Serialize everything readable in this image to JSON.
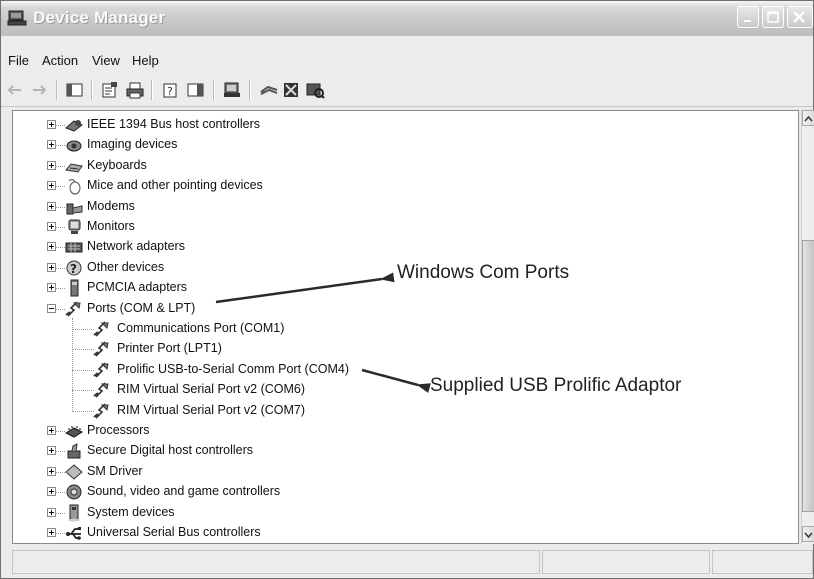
{
  "window": {
    "title": "Device Manager"
  },
  "menu": [
    "File",
    "Action",
    "View",
    "Help"
  ],
  "toolbar_icons": [
    "back-icon",
    "forward-icon",
    "show-hide-console-tree-icon",
    "properties-icon",
    "print-icon",
    "help-icon",
    "show-hide-action-pane-icon",
    "update-driver-icon",
    "uninstall-icon",
    "disable-icon",
    "scan-hardware-icon"
  ],
  "tree": [
    {
      "label": "IEEE 1394 Bus host controllers",
      "icon": "ieee1394-icon",
      "expander": "plus"
    },
    {
      "label": "Imaging devices",
      "icon": "camera-icon",
      "expander": "plus"
    },
    {
      "label": "Keyboards",
      "icon": "keyboard-icon",
      "expander": "plus"
    },
    {
      "label": "Mice and other pointing devices",
      "icon": "mouse-icon",
      "expander": "plus"
    },
    {
      "label": "Modems",
      "icon": "modem-icon",
      "expander": "plus"
    },
    {
      "label": "Monitors",
      "icon": "monitor-icon",
      "expander": "plus"
    },
    {
      "label": "Network adapters",
      "icon": "network-adapter-icon",
      "expander": "plus"
    },
    {
      "label": "Other devices",
      "icon": "other-devices-icon",
      "expander": "plus"
    },
    {
      "label": "PCMCIA adapters",
      "icon": "pcmcia-icon",
      "expander": "plus"
    },
    {
      "label": "Ports (COM & LPT)",
      "icon": "port-icon",
      "expander": "minus"
    },
    {
      "label": "Communications Port (COM1)",
      "icon": "port-icon",
      "child": true
    },
    {
      "label": "Printer Port (LPT1)",
      "icon": "port-icon",
      "child": true
    },
    {
      "label": "Prolific USB-to-Serial Comm Port (COM4)",
      "icon": "port-icon",
      "child": true
    },
    {
      "label": "RIM Virtual Serial Port v2 (COM6)",
      "icon": "port-icon",
      "child": true
    },
    {
      "label": "RIM Virtual Serial Port v2 (COM7)",
      "icon": "port-icon",
      "child": true
    },
    {
      "label": "Processors",
      "icon": "processor-icon",
      "expander": "plus"
    },
    {
      "label": "Secure Digital host controllers",
      "icon": "sd-controller-icon",
      "expander": "plus"
    },
    {
      "label": "SM Driver",
      "icon": "sm-driver-icon",
      "expander": "plus"
    },
    {
      "label": "Sound, video and game controllers",
      "icon": "sound-icon",
      "expander": "plus"
    },
    {
      "label": "System devices",
      "icon": "system-devices-icon",
      "expander": "plus"
    },
    {
      "label": "Universal Serial Bus controllers",
      "icon": "usb-icon",
      "expander": "plus"
    }
  ],
  "annotations": {
    "com_ports": "Windows Com Ports",
    "usb_adaptor": "Supplied USB Prolific Adaptor"
  }
}
